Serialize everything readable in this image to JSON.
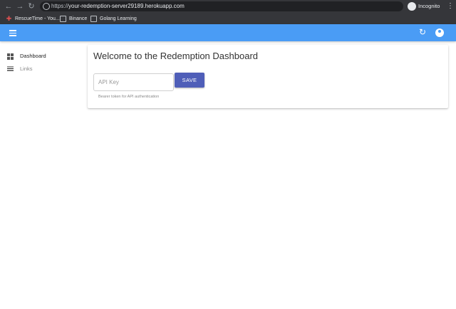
{
  "browser": {
    "url_prefix": "https://",
    "url_host": "your-redemption-server29189.herokuapp.com",
    "profile_label": "Incognito",
    "bookmarks": [
      {
        "label": "RescueTime - You..."
      },
      {
        "label": "Binance"
      },
      {
        "label": "Golang Learning"
      }
    ]
  },
  "sidebar": {
    "items": [
      {
        "label": "Dashboard",
        "icon": "dashboard-icon",
        "active": true
      },
      {
        "label": "Links",
        "icon": "list-icon",
        "active": false
      }
    ]
  },
  "main": {
    "title": "Welcome to the Redemption Dashboard",
    "api_key": {
      "placeholder": "API Key",
      "value": "",
      "helper": "Bearer token for API authentication"
    },
    "save_label": "SAVE"
  },
  "colors": {
    "appbar": "#4a9cf5",
    "save_button": "#4f5eb8",
    "chrome": "#35363a"
  }
}
